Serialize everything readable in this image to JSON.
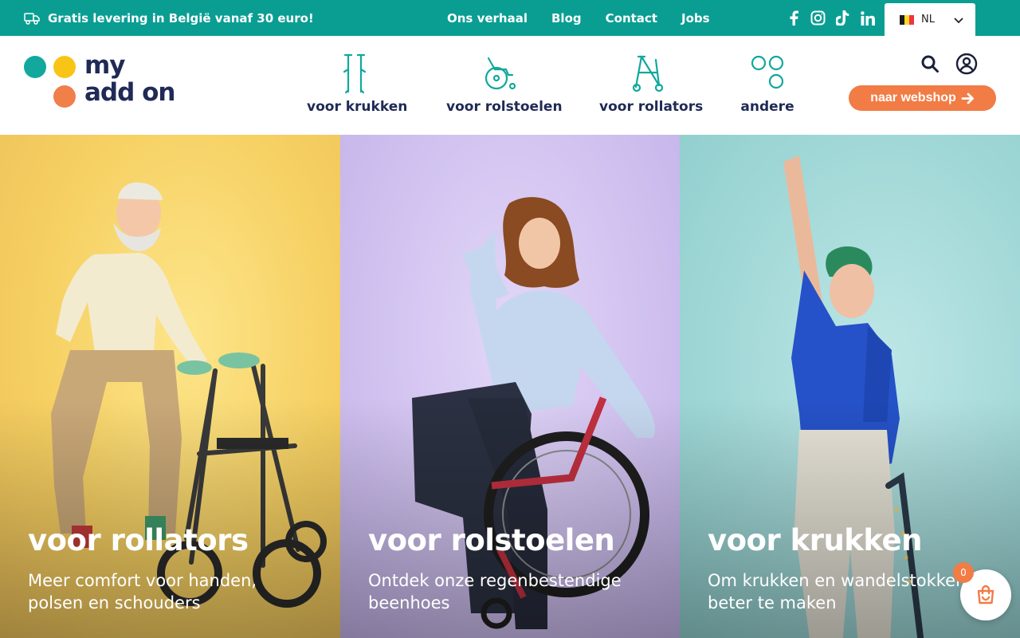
{
  "topbar": {
    "promo": "Gratis levering in België vanaf 30 euro!",
    "links": [
      "Ons verhaal",
      "Blog",
      "Contact",
      "Jobs"
    ],
    "social_icons": [
      "facebook-icon",
      "instagram-icon",
      "tiktok-icon",
      "linkedin-icon"
    ],
    "language": "NL"
  },
  "header": {
    "logo_line1": "my",
    "logo_line2": "add on",
    "categories": [
      {
        "label": "voor krukken",
        "icon": "crutches-icon"
      },
      {
        "label": "voor rolstoelen",
        "icon": "wheelchair-icon"
      },
      {
        "label": "voor rollators",
        "icon": "rollator-icon"
      },
      {
        "label": "andere",
        "icon": "circles-icon"
      }
    ],
    "webshop_label": "naar webshop"
  },
  "hero": {
    "panels": [
      {
        "title": "voor rollators",
        "subtitle": "Meer comfort voor handen, polsen en schouders"
      },
      {
        "title": "voor rolstoelen",
        "subtitle": "Ontdek onze regenbestendige beenhoes"
      },
      {
        "title": "voor krukken",
        "subtitle": "Om krukken en wandelstokken beter te maken"
      }
    ]
  },
  "cart": {
    "count": "0"
  },
  "colors": {
    "teal": "#0a9e93",
    "navy": "#1f2a56",
    "orange": "#f27c45",
    "yellow": "#f8c516"
  }
}
